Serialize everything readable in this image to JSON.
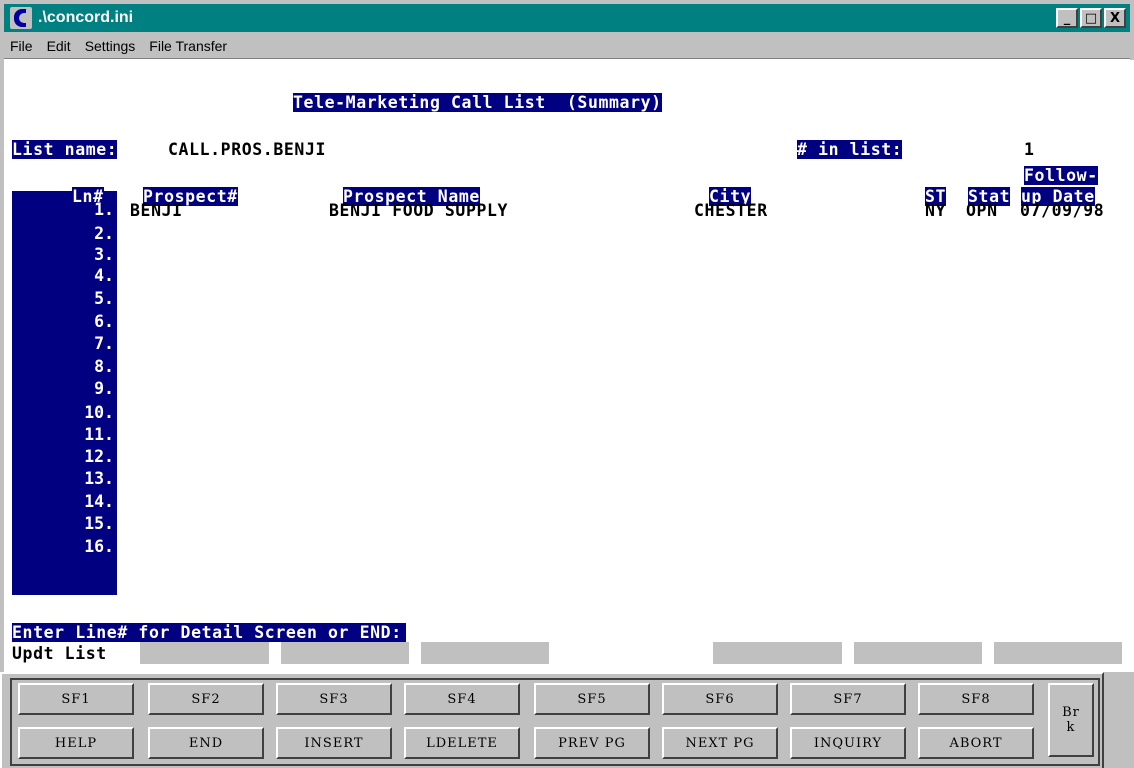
{
  "window": {
    "title": ".\\concord.ini",
    "controls": {
      "minimize": "_",
      "maximize": "□",
      "close": "X"
    }
  },
  "menubar": {
    "items": [
      "File",
      "Edit",
      "Settings",
      "File Transfer"
    ]
  },
  "screen": {
    "heading": "Tele-Marketing Call List  (Summary)",
    "list_name_label": "List name:",
    "list_name_value": "CALL.PROS.BENJI",
    "count_label": "# in list:",
    "count_value": "1",
    "followup_label": "Follow-",
    "columns": {
      "ln": "Ln#",
      "prospect_no": "Prospect#",
      "prospect_name": "Prospect Name",
      "city": "City",
      "st": "ST",
      "stat": "Stat",
      "followup_date": "up Date"
    },
    "rows": [
      {
        "ln": "1.",
        "prospect_no": "BENJI",
        "prospect_name": "BENJI FOOD SUPPLY",
        "city": "CHESTER",
        "st": "NY",
        "stat": "OPN",
        "date": "07/09/98"
      }
    ],
    "line_numbers": [
      "1.",
      "2.",
      "3.",
      "4.",
      "5.",
      "6.",
      "7.",
      "8.",
      "9.",
      "10.",
      "11.",
      "12.",
      "13.",
      "14.",
      "15.",
      "16."
    ],
    "prompt": "Enter Line# for Detail Screen or END:",
    "mode": "Updt List"
  },
  "function_keys": {
    "top": [
      "SF1",
      "SF2",
      "SF3",
      "SF4",
      "SF5",
      "SF6",
      "SF7",
      "SF8"
    ],
    "bottom": [
      "HELP",
      "END",
      "INSERT",
      "LDELETE",
      "PREV PG",
      "NEXT PG",
      "INQUIRY",
      "ABORT"
    ],
    "break_line1": "Br",
    "break_line2": "k"
  }
}
